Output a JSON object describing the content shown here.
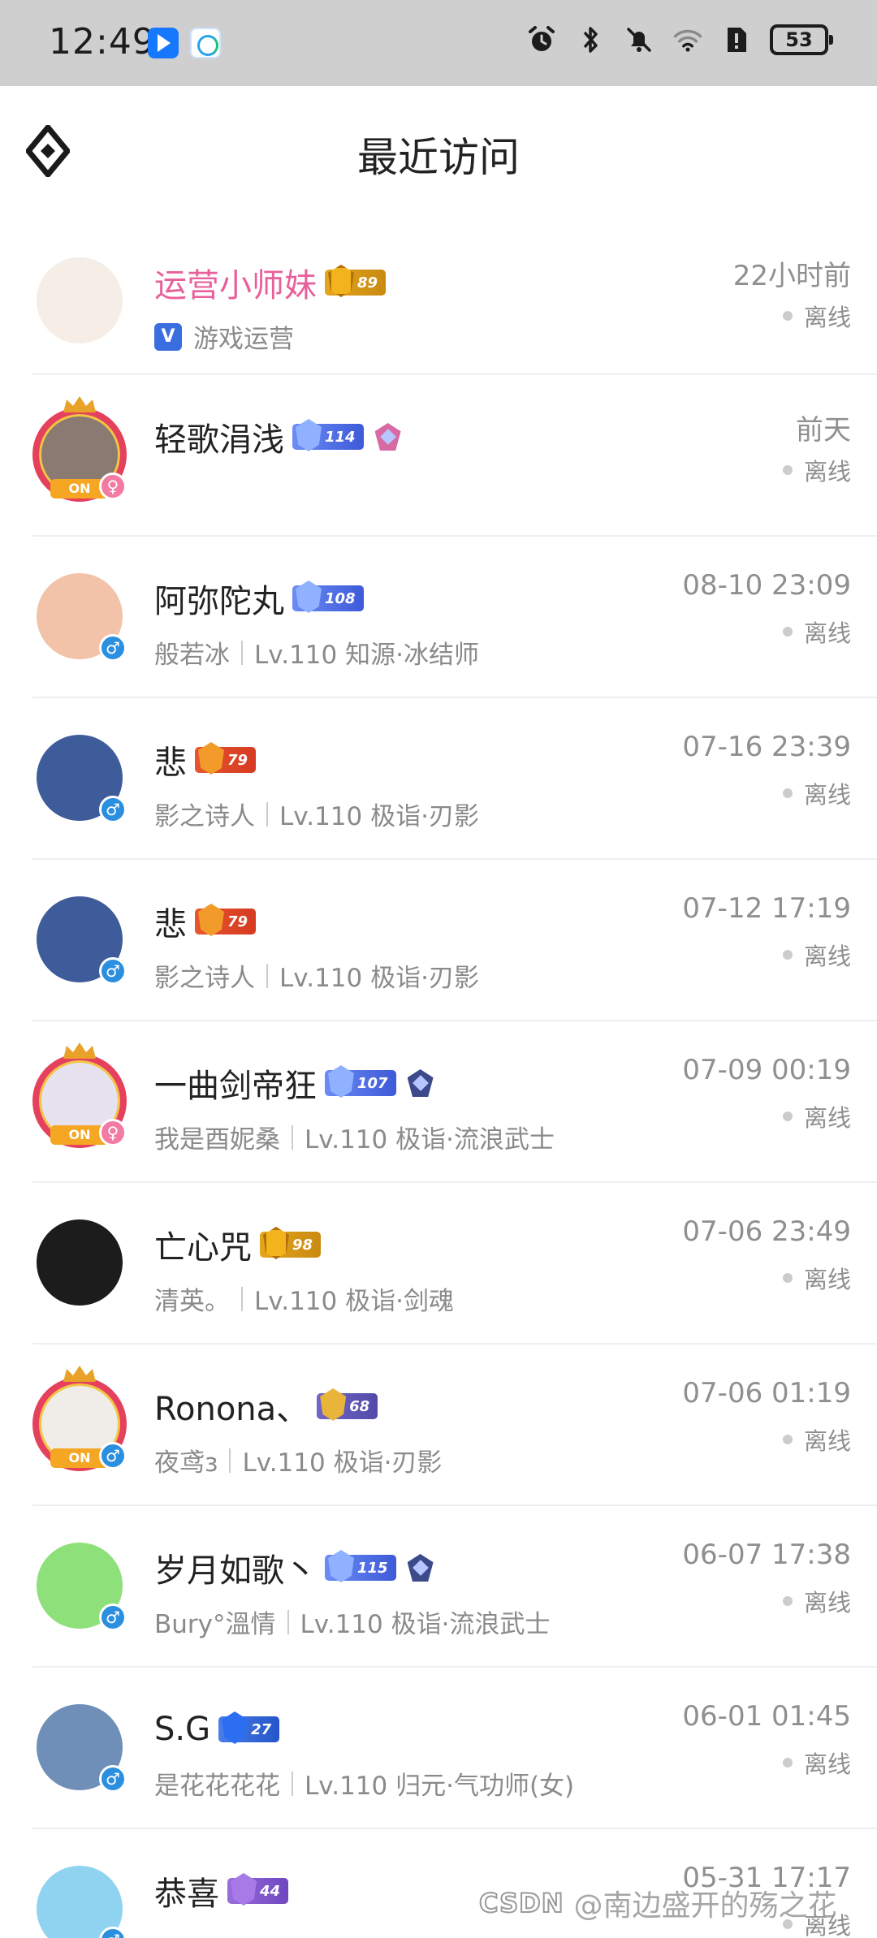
{
  "status_bar": {
    "time": "12:49",
    "battery": "53",
    "icons": [
      "alarm-icon",
      "bluetooth-icon",
      "mute-icon",
      "wifi-icon",
      "sim-icon"
    ]
  },
  "header": {
    "title": "最近访问",
    "nav_icon": "diamond-menu-icon"
  },
  "visitors": [
    {
      "name": "运营小师妹",
      "operator": true,
      "level": "89",
      "badge": "gold",
      "honor": "",
      "verified": "V",
      "sub1": "游戏运营",
      "sub2": "",
      "time": "22小时前",
      "status": "离线",
      "gender": "",
      "avatar_bg": "#f5ede6",
      "frame": false
    },
    {
      "name": "轻歌涓浅",
      "operator": false,
      "level": "114",
      "badge": "diamond",
      "honor": "pink",
      "verified": "",
      "sub1": "",
      "sub2": "",
      "time": "前天",
      "status": "离线",
      "gender": "♀",
      "avatar_bg": "#8a7a72",
      "frame": true,
      "plate": "ON"
    },
    {
      "name": "阿弥陀丸",
      "operator": false,
      "level": "108",
      "badge": "diamond",
      "honor": "",
      "verified": "",
      "sub1": "般若冰",
      "sub2": "Lv.110 知源·冰结师",
      "time": "08-10 23:09",
      "status": "离线",
      "gender": "♂",
      "avatar_bg": "#f2c3a8",
      "frame": false
    },
    {
      "name": "悲",
      "operator": false,
      "level": "79",
      "badge": "red",
      "honor": "",
      "verified": "",
      "sub1": "影之诗人",
      "sub2": "Lv.110 极诣·刃影",
      "time": "07-16 23:39",
      "status": "离线",
      "gender": "♂",
      "avatar_bg": "#3f5c9a",
      "frame": false
    },
    {
      "name": "悲",
      "operator": false,
      "level": "79",
      "badge": "red",
      "honor": "",
      "verified": "",
      "sub1": "影之诗人",
      "sub2": "Lv.110 极诣·刃影",
      "time": "07-12 17:19",
      "status": "离线",
      "gender": "♂",
      "avatar_bg": "#3f5c9a",
      "frame": false
    },
    {
      "name": "一曲剑帝狂",
      "operator": false,
      "level": "107",
      "badge": "diamond",
      "honor": "dark",
      "verified": "",
      "sub1": "我是酉妮桑",
      "sub2": "Lv.110 极诣·流浪武士",
      "time": "07-09 00:19",
      "status": "离线",
      "gender": "♀",
      "avatar_bg": "#e6e2f0",
      "frame": true,
      "plate": "ON"
    },
    {
      "name": "亡心咒",
      "operator": false,
      "level": "98",
      "badge": "gold",
      "honor": "",
      "verified": "",
      "sub1": "清英。",
      "sub2": "Lv.110 极诣·剑魂",
      "time": "07-06 23:49",
      "status": "离线",
      "gender": "",
      "avatar_bg": "#1c1c1c",
      "frame": false
    },
    {
      "name": "Ronona、",
      "operator": false,
      "level": "68",
      "badge": "gold2",
      "honor": "",
      "verified": "",
      "sub1": "夜鸢з",
      "sub2": "Lv.110 极诣·刃影",
      "time": "07-06 01:19",
      "status": "离线",
      "gender": "♂",
      "avatar_bg": "#f0ece8",
      "frame": true,
      "plate": "ON"
    },
    {
      "name": "岁月如歌丶",
      "operator": false,
      "level": "115",
      "badge": "diamond",
      "honor": "dark",
      "verified": "",
      "sub1": "Bury°溫情",
      "sub2": "Lv.110 极诣·流浪武士",
      "time": "06-07 17:38",
      "status": "离线",
      "gender": "♂",
      "avatar_bg": "#8ee07a",
      "frame": false
    },
    {
      "name": "S.G",
      "operator": false,
      "level": "27",
      "badge": "blue",
      "honor": "",
      "verified": "",
      "sub1": "是花花花花",
      "sub2": "Lv.110 归元·气功师(女)",
      "time": "06-01 01:45",
      "status": "离线",
      "gender": "♂",
      "avatar_bg": "#6f8fb8",
      "frame": false
    },
    {
      "name": "恭喜",
      "operator": false,
      "level": "44",
      "badge": "purple",
      "honor": "",
      "verified": "",
      "sub1": "",
      "sub2": "",
      "time": "05-31 17:17",
      "status": "离线",
      "gender": "♂",
      "avatar_bg": "#8fd3f0",
      "frame": false
    }
  ],
  "watermark": {
    "logo": "CSDN",
    "text": "@南边盛开的殇之花"
  }
}
